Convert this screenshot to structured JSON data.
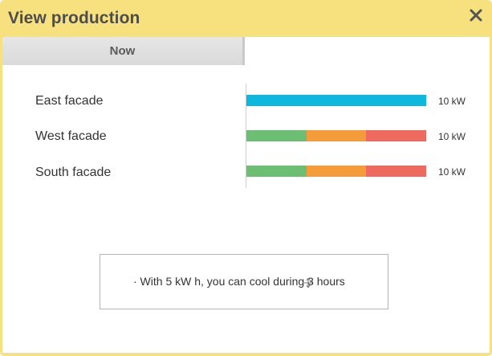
{
  "dialog": {
    "title": "View production",
    "close_icon": "close-icon"
  },
  "tabs": [
    {
      "label": "Now",
      "selected": true
    }
  ],
  "rows": [
    {
      "label": "East facade",
      "value_label": "10 kW",
      "segments": [
        {
          "fraction": 1.0,
          "color": "#0db8dc"
        }
      ]
    },
    {
      "label": "West facade",
      "value_label": "10 kW",
      "segments": [
        {
          "fraction": 0.333,
          "color": "#6cbf72"
        },
        {
          "fraction": 0.334,
          "color": "#f49b3a"
        },
        {
          "fraction": 0.333,
          "color": "#ef6a5e"
        }
      ]
    },
    {
      "label": "South facade",
      "value_label": "10 kW",
      "segments": [
        {
          "fraction": 0.333,
          "color": "#6cbf72"
        },
        {
          "fraction": 0.334,
          "color": "#f49b3a"
        },
        {
          "fraction": 0.333,
          "color": "#ef6a5e"
        }
      ]
    }
  ],
  "info": {
    "text": "· With 5 kW h, you can cool during 3 hours"
  },
  "colors": {
    "header": "#f7e07e",
    "title_text": "#4d4d4d"
  }
}
